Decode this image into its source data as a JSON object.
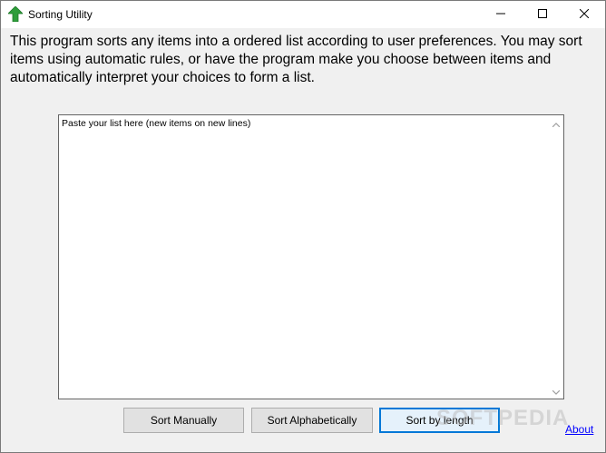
{
  "window": {
    "title": "Sorting Utility",
    "minimize_icon": "minimize-icon",
    "maximize_icon": "maximize-icon",
    "close_icon": "close-icon"
  },
  "intro": {
    "text": "This program sorts any items into a ordered list according to user preferences. You may sort items using automatic rules, or have the program make you choose between items and automatically interpret your choices to form a list."
  },
  "list_input": {
    "value": "Paste your list here (new items on new lines)"
  },
  "buttons": {
    "sort_manually": "Sort Manually",
    "sort_alphabetically": "Sort Alphabetically",
    "sort_by_length": "Sort by length"
  },
  "about_link": "About",
  "watermark": "SOFTPEDIA",
  "colors": {
    "app_icon": "#2e9d3a",
    "focus_border": "#0078d7",
    "link": "#0000ff"
  }
}
